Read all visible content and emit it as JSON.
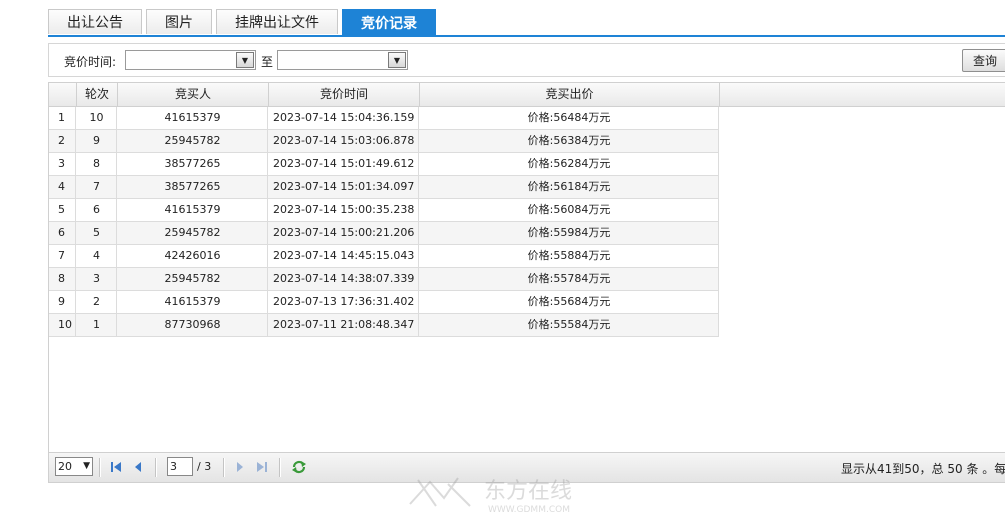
{
  "tabs": [
    {
      "label": "出让公告",
      "active": false
    },
    {
      "label": "图片",
      "active": false
    },
    {
      "label": "挂牌出让文件",
      "active": false
    },
    {
      "label": "竞价记录",
      "active": true
    }
  ],
  "filter": {
    "time_label": "竞价时间:",
    "to_label": "至",
    "query_button": "查询"
  },
  "grid": {
    "headers": [
      "轮次",
      "竞买人",
      "竞价时间",
      "竞买出价"
    ],
    "rows": [
      {
        "index": "1",
        "round": "10",
        "bidder": "41615379",
        "time": "2023-07-14 15:04:36.159",
        "price": "价格:56484万元"
      },
      {
        "index": "2",
        "round": "9",
        "bidder": "25945782",
        "time": "2023-07-14 15:03:06.878",
        "price": "价格:56384万元"
      },
      {
        "index": "3",
        "round": "8",
        "bidder": "38577265",
        "time": "2023-07-14 15:01:49.612",
        "price": "价格:56284万元"
      },
      {
        "index": "4",
        "round": "7",
        "bidder": "38577265",
        "time": "2023-07-14 15:01:34.097",
        "price": "价格:56184万元"
      },
      {
        "index": "5",
        "round": "6",
        "bidder": "41615379",
        "time": "2023-07-14 15:00:35.238",
        "price": "价格:56084万元"
      },
      {
        "index": "6",
        "round": "5",
        "bidder": "25945782",
        "time": "2023-07-14 15:00:21.206",
        "price": "价格:55984万元"
      },
      {
        "index": "7",
        "round": "4",
        "bidder": "42426016",
        "time": "2023-07-14 14:45:15.043",
        "price": "价格:55884万元"
      },
      {
        "index": "8",
        "round": "3",
        "bidder": "25945782",
        "time": "2023-07-14 14:38:07.339",
        "price": "价格:55784万元"
      },
      {
        "index": "9",
        "round": "2",
        "bidder": "41615379",
        "time": "2023-07-13 17:36:31.402",
        "price": "价格:55684万元"
      },
      {
        "index": "10",
        "round": "1",
        "bidder": "87730968",
        "time": "2023-07-11 21:08:48.347",
        "price": "价格:55584万元"
      }
    ]
  },
  "pager": {
    "page_size": "20",
    "current_page": "3",
    "total_pages": "/ 3",
    "info": "显示从41到50，总 50 条 。每"
  },
  "watermark": {
    "text": "东方在线",
    "url_text": "WWW.GDMM.COM"
  },
  "colors": {
    "accent": "#1e83d6",
    "nav_icon": "#3a78c8",
    "refresh_icon": "#3a9a3a"
  },
  "icons": {
    "dropdown": "chevron-down-icon",
    "first": "first-page-icon",
    "prev": "prev-page-icon",
    "next": "next-page-icon",
    "last": "last-page-icon",
    "refresh": "refresh-icon"
  }
}
